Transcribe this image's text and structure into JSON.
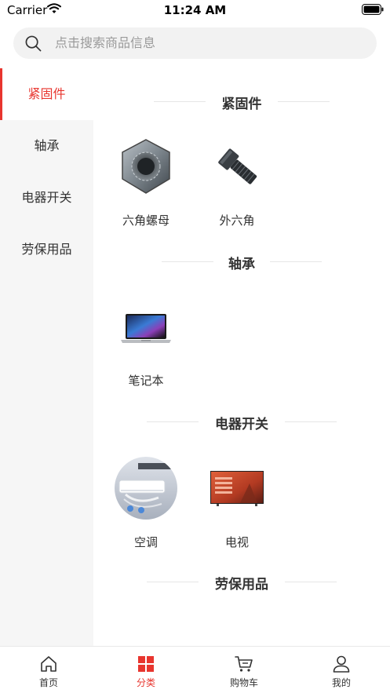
{
  "status_bar": {
    "carrier": "Carrier",
    "time": "11:24 AM"
  },
  "search": {
    "placeholder": "点击搜索商品信息"
  },
  "sidebar": {
    "items": [
      {
        "label": "紧固件",
        "active": true
      },
      {
        "label": "轴承",
        "active": false
      },
      {
        "label": "电器开关",
        "active": false
      },
      {
        "label": "劳保用品",
        "active": false
      }
    ]
  },
  "sections": [
    {
      "title": "紧固件",
      "products": [
        {
          "name": "六角螺母"
        },
        {
          "name": "外六角"
        }
      ]
    },
    {
      "title": "轴承",
      "products": [
        {
          "name": "笔记本"
        }
      ]
    },
    {
      "title": "电器开关",
      "products": [
        {
          "name": "空调"
        },
        {
          "name": "电视"
        }
      ]
    },
    {
      "title": "劳保用品",
      "products": []
    }
  ],
  "tabbar": {
    "items": [
      {
        "label": "首页",
        "icon": "home-icon",
        "active": false
      },
      {
        "label": "分类",
        "icon": "category-icon",
        "active": true
      },
      {
        "label": "购物车",
        "icon": "cart-icon",
        "active": false
      },
      {
        "label": "我的",
        "icon": "profile-icon",
        "active": false
      }
    ]
  },
  "colors": {
    "accent": "#e8352e",
    "sidebar_bg": "#f6f6f6",
    "search_bg": "#f2f2f2"
  }
}
